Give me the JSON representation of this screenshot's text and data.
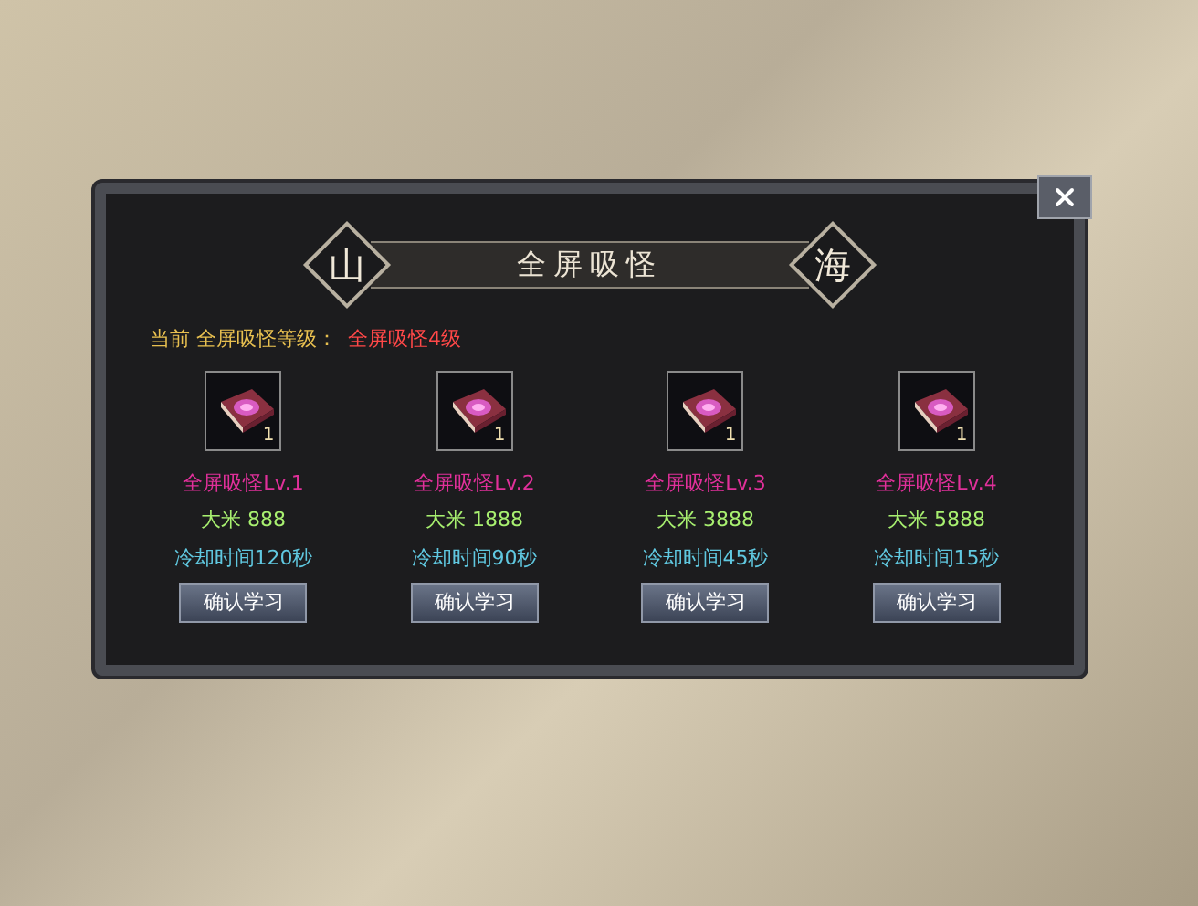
{
  "dialog": {
    "title": "全屏吸怪",
    "left_emblem": "山",
    "right_emblem": "海"
  },
  "current": {
    "label": "当前 全屏吸怪等级：",
    "value": "全屏吸怪4级"
  },
  "skills": [
    {
      "count": "1",
      "name": "全屏吸怪Lv.1",
      "cost": "大米 888",
      "cooldown": "冷却时间120秒",
      "button": "确认学习"
    },
    {
      "count": "1",
      "name": "全屏吸怪Lv.2",
      "cost": "大米 1888",
      "cooldown": "冷却时间90秒",
      "button": "确认学习"
    },
    {
      "count": "1",
      "name": "全屏吸怪Lv.3",
      "cost": "大米 3888",
      "cooldown": "冷却时间45秒",
      "button": "确认学习"
    },
    {
      "count": "1",
      "name": "全屏吸怪Lv.4",
      "cost": "大米 5888",
      "cooldown": "冷却时间15秒",
      "button": "确认学习"
    }
  ]
}
